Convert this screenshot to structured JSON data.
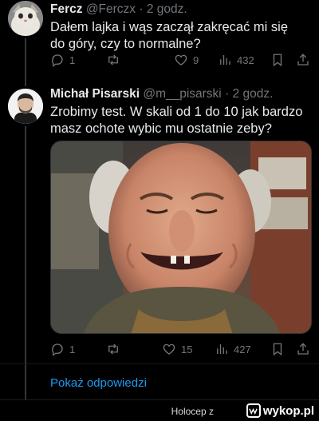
{
  "tweets": [
    {
      "name": "Fercz",
      "handle": "@Ferczx",
      "time": "· 2 godz.",
      "text": "Dałem lajka i wąs zaczął zakręcać mi się do góry, czy to normalne?",
      "replies": "1",
      "retweets": "",
      "likes": "9",
      "views": "432",
      "avatar_icon": "cat-avatar"
    },
    {
      "name": "Michał Pisarski",
      "handle": "@m__pisarski",
      "time": "· 2 godz.",
      "text": "Zrobimy test. W skali od 1 do 10 jak bardzo masz ochote wybic mu ostatnie zeby?",
      "replies": "1",
      "retweets": "",
      "likes": "15",
      "views": "427",
      "avatar_icon": "man-avatar",
      "media_icon": "smiling-man-photo"
    }
  ],
  "show_replies": "Pokaż odpowiedzi",
  "watermark": {
    "user": "Holocep",
    "sep": "z",
    "brand": "wykop.pl"
  },
  "colors": {
    "background": "#000000",
    "text": "#e7e9ea",
    "muted": "#71767b",
    "link": "#1d9bf0"
  }
}
